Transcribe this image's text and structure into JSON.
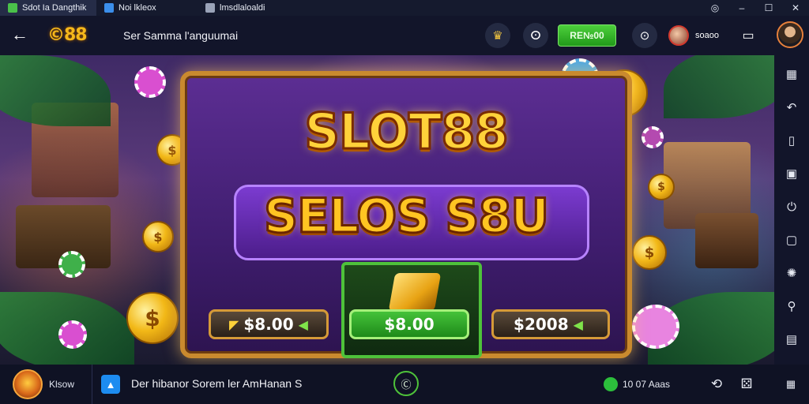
{
  "tabs": [
    {
      "label": "Sdot Ia Dangthik",
      "icon": "game-tab-icon",
      "color": "#4ac04a"
    },
    {
      "label": "Noi lkleox",
      "icon": "blue-app-icon",
      "color": "#3b8eea"
    },
    {
      "label": "lmsdlaloaldi",
      "icon": "page-icon",
      "color": "#9aa3b8"
    }
  ],
  "window_controls": {
    "location": "◎",
    "minimize": "–",
    "maximize": "☐",
    "close": "✕"
  },
  "header": {
    "back": "←",
    "logo": "©88",
    "title": "Ser Samma l'anguumai",
    "icons": {
      "gift": "♛",
      "search": "ⵙ",
      "chat": "⊙"
    },
    "cash_button": "RЕ№00",
    "username": "soaoo"
  },
  "game": {
    "title_line1": "SLOT88",
    "title_line2": "SELOS S8U",
    "bets": [
      "$8.00",
      "$8.00",
      "$2008"
    ]
  },
  "sidebar": {
    "icons": [
      "grid-icon",
      "undo-icon",
      "book-icon",
      "note-icon",
      "power-icon",
      "message-icon",
      "settings-icon",
      "search-icon",
      "list-icon"
    ],
    "glyphs": [
      "▦",
      "↶",
      "▯",
      "▣",
      "⏻",
      "▢",
      "✺",
      "⚲",
      "▤"
    ]
  },
  "bottombar": {
    "label": "Klsow",
    "text": "Der hibanor Sorem ler AmHanan S",
    "center_glyph": "Ⓒ",
    "status": "10 07 Aaas",
    "actions": [
      "⟲",
      "⚄"
    ]
  },
  "colors": {
    "accent": "#f5b81b",
    "cash_green": "#2cbe3c",
    "board_purple": "#4c1d8a"
  }
}
